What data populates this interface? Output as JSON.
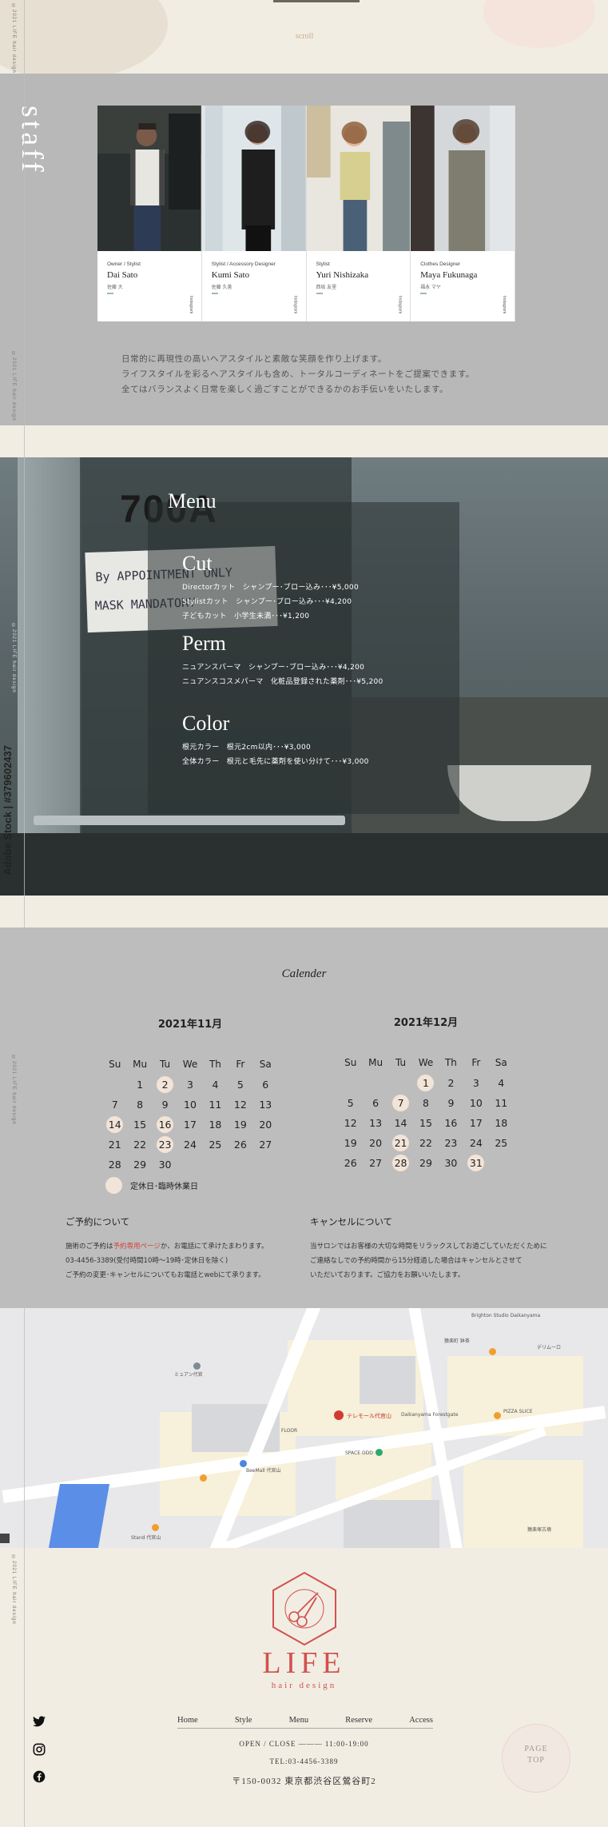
{
  "top": {
    "scroll_label": "scroll"
  },
  "copyright": "©2021 LIFE hair design",
  "staff": {
    "section_title": "staff",
    "members": [
      {
        "role": "Owner / Stylist",
        "name": "Dai Sato",
        "kana": "佐藤 大",
        "ig": "Instagram"
      },
      {
        "role": "Stylist / Accessory Designer",
        "name": "Kumi Sato",
        "kana": "佐藤 久美",
        "ig": "Instagram"
      },
      {
        "role": "Stylist",
        "name": "Yuri Nishizaka",
        "kana": "西坂 友里",
        "ig": "Instagram"
      },
      {
        "role": "Clothes Designer",
        "name": "Maya Fukunaga",
        "kana": "福永 マヤ",
        "ig": "Instagram"
      }
    ],
    "description": [
      "日常的に再現性の高いヘアスタイルと素敵な笑顔を作り上げます。",
      "ライフスタイルを彩るヘアスタイルも含め、トータルコーディネートをご提案できます。",
      "全てはバランスよく日常を楽しく過ごすことができるかのお手伝いをいたします。"
    ]
  },
  "menu": {
    "title": "Menu",
    "bg_door_number": "700A",
    "bg_sign_line1": "By APPOINTMENT ONLY",
    "bg_sign_line2": "MASK MANDATORY",
    "stock_label": "Adobe Stock | #379602437",
    "sections": [
      {
        "name": "Cut",
        "items": [
          "Directorカット　シャンプー･ブロー込み･･･¥5,000",
          "Stylistカット　シャンプー･ブロー込み･･･¥4,200",
          "子どもカット　小学生未満･･･¥1,200"
        ]
      },
      {
        "name": "Perm",
        "items": [
          "ニュアンスパーマ　シャンプー･ブロー込み･･･¥4,200",
          "ニュアンスコスメパーマ　化粧品登録された薬剤･･･¥5,200"
        ]
      },
      {
        "name": "Color",
        "items": [
          "根元カラー　根元2cm以内･･･¥3,000",
          "全体カラー　根元と毛先に薬剤を使い分けて･･･¥3,000"
        ]
      }
    ]
  },
  "calendar": {
    "title": "Calender",
    "weekdays": [
      "Su",
      "Mu",
      "Tu",
      "We",
      "Th",
      "Fr",
      "Sa"
    ],
    "months": [
      {
        "label": "2021年11月",
        "offset": 1,
        "days": 30,
        "holidays": [
          2,
          14,
          16,
          23
        ]
      },
      {
        "label": "2021年12月",
        "offset": 3,
        "days": 31,
        "holidays": [
          1,
          7,
          21,
          28,
          31
        ]
      }
    ],
    "legend": "定休日･臨時休業日",
    "reserve": {
      "heading": "ご予約について",
      "line1_pre": "施術のご予約は",
      "line1_link": "予約専用ページ",
      "line1_post": "か、お電話にて承けたまわります。",
      "line2": "03-4456-3389(受付時間10時～19時･定休日を除く)",
      "line3": "ご予約の変更･キャンセルについてもお電話とwebにて承ります。"
    },
    "cancel": {
      "heading": "キャンセルについて",
      "line1": "当サロンではお客様の大切な時間をリラックスしてお過ごしていただくために",
      "line2": "ご連絡なしでの予約時間から15分経過した場合はキャンセルとさせて",
      "line3": "いただいております。ご協力をお願いいたします。"
    }
  },
  "map": {
    "marker_label": "テレモール代官山",
    "labels": [
      "Brighton Studio Daikanyama",
      "猿楽町 鉢茶",
      "デリムーロ",
      "ミュアン代官",
      "FLOOR",
      "SPACE ODD",
      "BeeMall 代官山",
      "Daikanyama Forestgate",
      "PIZZA SLICE",
      "Stand 代官山",
      "猿楽塚古墳"
    ]
  },
  "footer": {
    "logo": "LIFE",
    "logo_sub": "hair design",
    "nav": [
      "Home",
      "Style",
      "Menu",
      "Reserve",
      "Access"
    ],
    "hours": "OPEN / CLOSE ――― 11:00-19:00",
    "tel": "TEL:03-4456-3389",
    "address": "〒150-0032 東京都渋谷区鶯谷町2",
    "page_top_1": "PAGE",
    "page_top_2": "TOP"
  }
}
